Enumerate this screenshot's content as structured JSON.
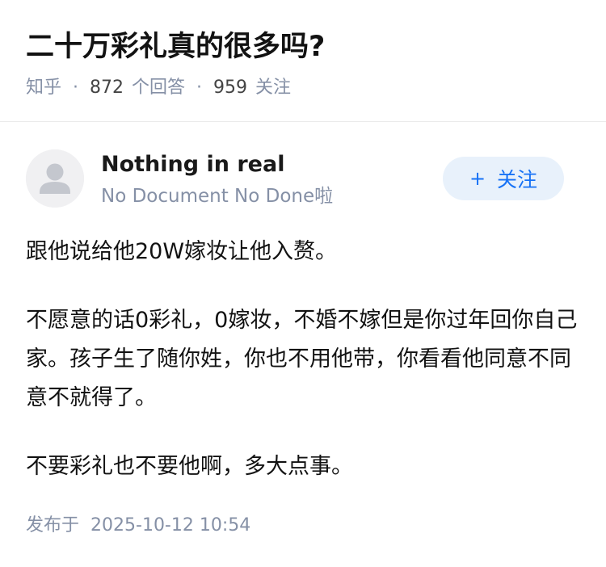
{
  "question": {
    "title": "二十万彩礼真的很多吗?",
    "source": "知乎",
    "answer_count": "872",
    "answer_label": "个回答",
    "follower_count": "959",
    "follower_label": "关注",
    "separator": "·"
  },
  "author": {
    "name": "Nothing in real",
    "bio": "No Document No Done啦",
    "avatar_icon": "default-avatar-icon",
    "follow_plus": "+",
    "follow_label": "关注"
  },
  "answer": {
    "paragraphs": [
      "跟他说给他20W嫁妆让他入赘。",
      "不愿意的话0彩礼，0嫁妆，不婚不嫁但是你过年回你自己家。孩子生了随你姓，你也不用他带，你看看他同意不同意不就得了。",
      "不要彩礼也不要他啊，多大点事。"
    ],
    "published_label": "发布于",
    "published_time": "2025-10-12 10:54"
  },
  "colors": {
    "accent": "#1772f6",
    "follow_bg": "#e8f1fb",
    "meta_text": "#8590a6",
    "divider": "#ebebeb"
  }
}
